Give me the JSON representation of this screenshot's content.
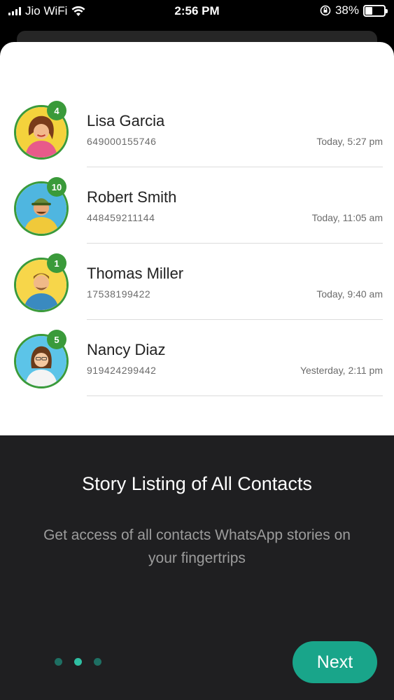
{
  "status_bar": {
    "carrier": "Jio WiFi",
    "time": "2:56 PM",
    "battery": "38%",
    "battery_level": 0.38
  },
  "contacts": [
    {
      "name": "Lisa Garcia",
      "phone": "649000155746",
      "time": "Today, 5:27 pm",
      "count": "4"
    },
    {
      "name": "Robert Smith",
      "phone": "448459211144",
      "time": "Today, 11:05 am",
      "count": "10"
    },
    {
      "name": "Thomas Miller",
      "phone": "17538199422",
      "time": "Today, 9:40 am",
      "count": "1"
    },
    {
      "name": "Nancy Diaz",
      "phone": "919424299442",
      "time": "Yesterday, 2:11 pm",
      "count": "5"
    }
  ],
  "onboarding": {
    "title": "Story Listing of All Contacts",
    "description": "Get access of all contacts WhatsApp stories on your fingertrips",
    "next_label": "Next",
    "page_index": 2,
    "page_count": 3
  },
  "colors": {
    "accent": "#19a58a",
    "badge": "#3a9a3a",
    "panel": "#1f1f21"
  }
}
